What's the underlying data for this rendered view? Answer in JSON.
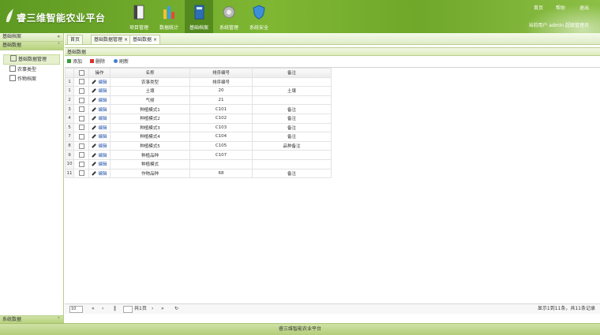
{
  "header": {
    "title": "睿三维智能农业平台",
    "modules": [
      {
        "label": "项目管理",
        "icon": "document-icon"
      },
      {
        "label": "数据统计",
        "icon": "bar-chart-icon"
      },
      {
        "label": "基础档案",
        "icon": "book-icon"
      },
      {
        "label": "系统管理",
        "icon": "gear-icon"
      },
      {
        "label": "系统安全",
        "icon": "shield-icon"
      }
    ],
    "top_links": [
      "首页",
      "帮助",
      "退出"
    ],
    "user_info": "当前用户 admin 超级管理员"
  },
  "sidebar": {
    "panel_title": "基础档案",
    "sub_title": "基础数据",
    "items": [
      "基础数据管理",
      "农事类型",
      "作物档案"
    ],
    "bottom_title": "系统数据"
  },
  "tabs": [
    "首页",
    "基础数据管理",
    "基础数据"
  ],
  "content_title": "基础数据",
  "toolbar": {
    "add": "添加",
    "delete": "删除",
    "refresh": "刷新"
  },
  "grid": {
    "columns": [
      "操作",
      "名称",
      "排序编号",
      "备注"
    ],
    "op_label": "编辑",
    "rows": [
      {
        "rn": "1",
        "name": "农事类型",
        "code": "排序编号",
        "note": ""
      },
      {
        "rn": "1",
        "name": "土壤",
        "code": "20",
        "note": "土壤"
      },
      {
        "rn": "2",
        "name": "气候",
        "code": "21",
        "note": ""
      },
      {
        "rn": "3",
        "name": "种植模式1",
        "code": "C101",
        "note": "备注"
      },
      {
        "rn": "4",
        "name": "种植模式2",
        "code": "C102",
        "note": "备注"
      },
      {
        "rn": "5",
        "name": "种植模式3",
        "code": "C103",
        "note": "备注"
      },
      {
        "rn": "7",
        "name": "种植模式4",
        "code": "C104",
        "note": "备注"
      },
      {
        "rn": "8",
        "name": "种植模式5",
        "code": "C105",
        "note": "品种备注"
      },
      {
        "rn": "9",
        "name": "种植品种",
        "code": "C107",
        "note": ""
      },
      {
        "rn": "10",
        "name": "种植模式",
        "code": "",
        "note": ""
      },
      {
        "rn": "11",
        "name": "作物品种",
        "code": "68",
        "note": "备注"
      }
    ]
  },
  "pager": {
    "page_size": "10",
    "page_label": "共1页",
    "info": "显示1到11条，共11条记录"
  },
  "footer": "睿三维智能农业平台"
}
